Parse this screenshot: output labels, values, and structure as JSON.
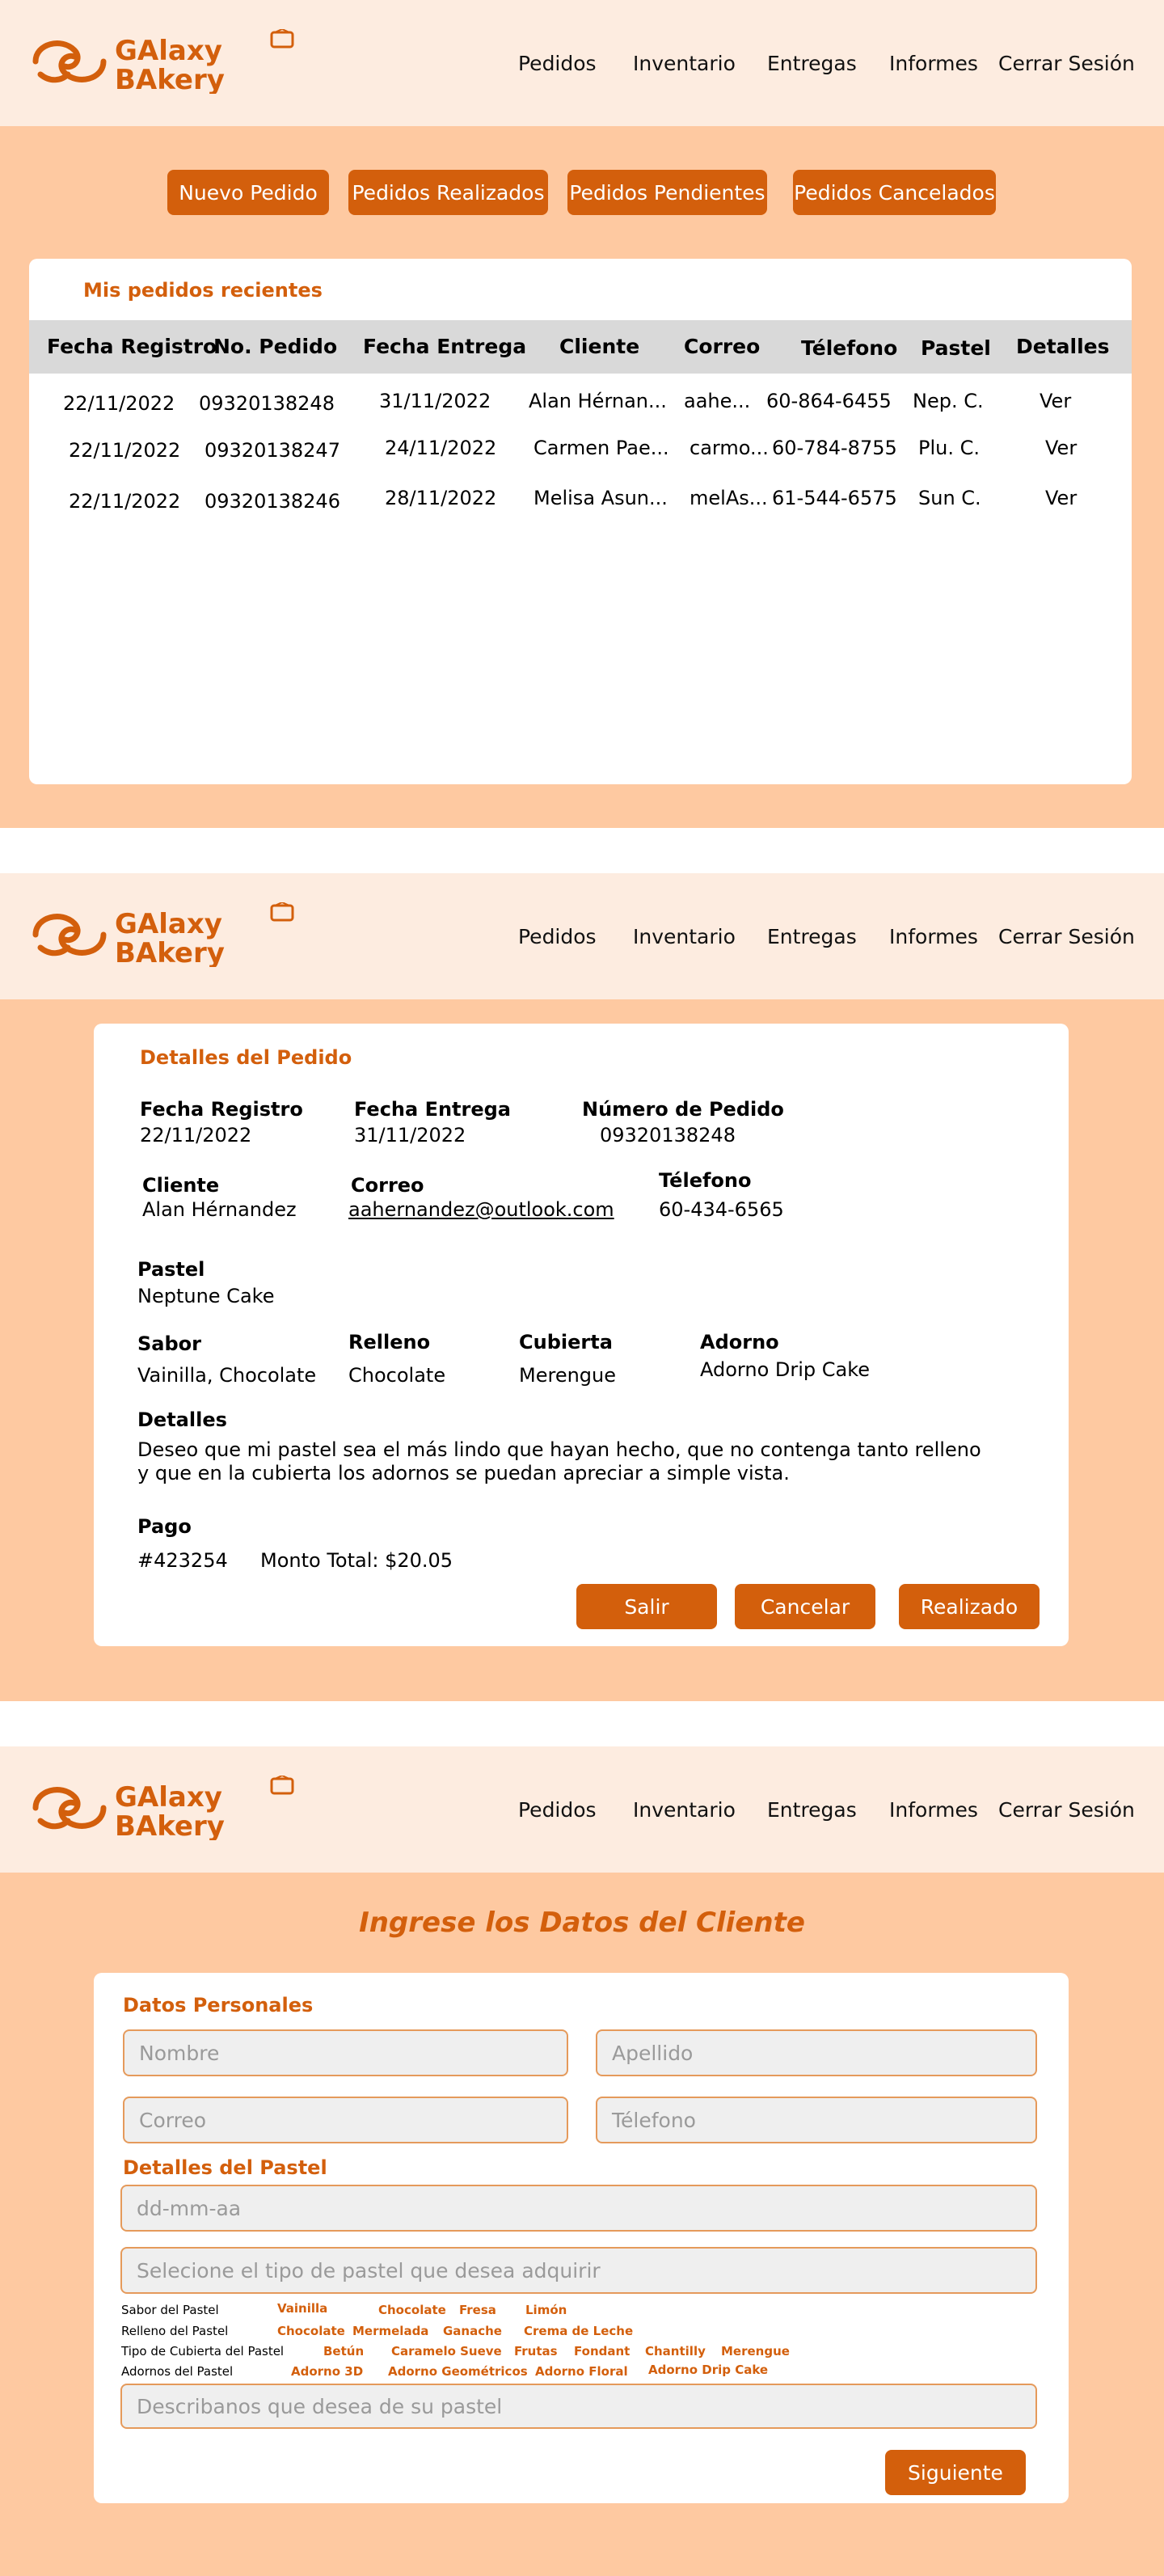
{
  "brand": {
    "logo_line1": "GAlaxy",
    "logo_line2": "BAkery",
    "color": "#d35f0c"
  },
  "nav": [
    "Pedidos",
    "Inventario",
    "Entregas",
    "Informes",
    "Cerrar Sesión"
  ],
  "orders": {
    "buttons": [
      "Nuevo Pedido",
      "Pedidos Realizados",
      "Pedidos Pendientes",
      "Pedidos Cancelados"
    ],
    "card_title": "Mis pedidos recientes",
    "columns": [
      "Fecha Registro",
      "No. Pedido",
      "Fecha Entrega",
      "Cliente",
      "Correo",
      "Télefono",
      "Pastel",
      "Detalles"
    ],
    "rows": [
      [
        "22/11/2022",
        "09320138248",
        "31/11/2022",
        "Alan Hérnan...",
        "aahe...",
        "60-864-6455",
        "Nep. C.",
        "Ver"
      ],
      [
        "22/11/2022",
        "09320138247",
        "24/11/2022",
        "Carmen Pae...",
        "carmo...",
        "60-784-8755",
        "Plu. C.",
        "Ver"
      ],
      [
        "22/11/2022",
        "09320138246",
        "28/11/2022",
        "Melisa Asun...",
        "melAs...",
        "61-544-6575",
        "Sun C.",
        "Ver"
      ]
    ]
  },
  "detail": {
    "title": "Detalles del Pedido",
    "fecha_registro": {
      "label": "Fecha Registro",
      "value": "22/11/2022"
    },
    "fecha_entrega": {
      "label": "Fecha Entrega",
      "value": "31/11/2022"
    },
    "numero_pedido": {
      "label": "Número de Pedido",
      "value": "09320138248"
    },
    "cliente": {
      "label": "Cliente",
      "value": "Alan Hérnandez"
    },
    "correo": {
      "label": "Correo",
      "value": "aahernandez@outlook.com"
    },
    "telefono": {
      "label": "Télefono",
      "value": "60-434-6565"
    },
    "pastel": {
      "label": "Pastel",
      "value": "Neptune Cake"
    },
    "sabor": {
      "label": "Sabor",
      "value": "Vainilla, Chocolate"
    },
    "relleno": {
      "label": "Relleno",
      "value": "Chocolate"
    },
    "cubierta": {
      "label": "Cubierta",
      "value": "Merengue"
    },
    "adorno": {
      "label": "Adorno",
      "value": "Adorno Drip Cake"
    },
    "detalles": {
      "label": "Detalles",
      "line1": "Deseo que mi pastel sea el más lindo que hayan hecho, que no contenga tanto relleno",
      "line2": "y que en la cubierta los adornos se puedan apreciar a simple vista."
    },
    "pago": {
      "label": "Pago",
      "id": "#423254",
      "total": "Monto Total: $20.05"
    },
    "buttons": [
      "Salir",
      "Cancelar",
      "Realizado"
    ]
  },
  "form": {
    "title": "Ingrese los Datos del Cliente",
    "section_personal": "Datos Personales",
    "placeholders": {
      "nombre": "Nombre",
      "apellido": "Apellido",
      "correo": "Correo",
      "telefono": "Télefono",
      "fecha": "dd-mm-aa",
      "tipo": "Selecione el tipo de pastel que desea adquirir",
      "describe": "Describanos que desea de su pastel"
    },
    "section_pastel": "Detalles del Pastel",
    "option_rows": [
      {
        "label": "Sabor del Pastel",
        "options": [
          "Vainilla",
          "Chocolate",
          "Fresa",
          "Limón"
        ]
      },
      {
        "label": "Relleno del Pastel",
        "options": [
          "Chocolate",
          "Mermelada",
          "Ganache",
          "Crema de Leche"
        ]
      },
      {
        "label": "Tipo de Cubierta del Pastel",
        "options": [
          "Betún",
          "Caramelo Sueve",
          "Frutas",
          "Fondant",
          "Chantilly",
          "Merengue"
        ]
      },
      {
        "label": "Adornos del Pastel",
        "options": [
          "Adorno 3D",
          "Adorno Geométricos",
          "Adorno Floral",
          "Adorno Drip Cake"
        ]
      }
    ],
    "next_button": "Siguiente"
  }
}
